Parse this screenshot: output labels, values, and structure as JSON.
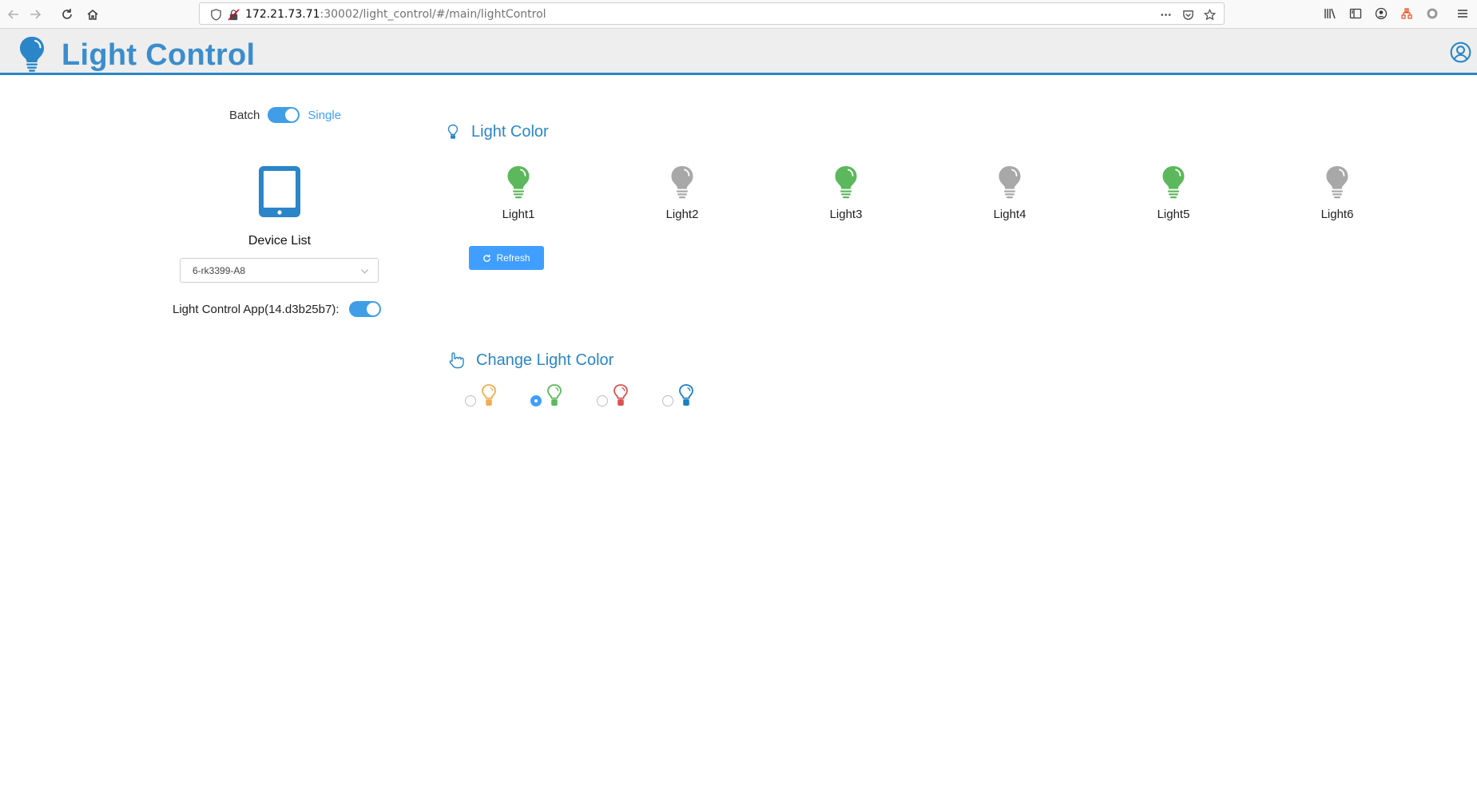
{
  "browser": {
    "url_host": "172.21.73.71",
    "url_rest": ":30002/light_control/#/main/lightControl"
  },
  "header": {
    "title": "Light Control"
  },
  "left_panel": {
    "mode_toggle": {
      "left_label": "Batch",
      "right_label": "Single",
      "active": "Single"
    },
    "device_list_title": "Device List",
    "device_select_value": "6-rk3399-A8",
    "app_toggle_label": "Light Control App(14.d3b25b7):",
    "app_toggle_on": true
  },
  "light_color": {
    "title": "Light Color",
    "lights": [
      {
        "label": "Light1",
        "state": "on"
      },
      {
        "label": "Light2",
        "state": "off"
      },
      {
        "label": "Light3",
        "state": "on"
      },
      {
        "label": "Light4",
        "state": "off"
      },
      {
        "label": "Light5",
        "state": "on"
      },
      {
        "label": "Light6",
        "state": "off"
      }
    ],
    "refresh_label": "Refresh"
  },
  "change_light_color": {
    "title": "Change Light Color",
    "options": [
      {
        "color": "#f0ad4e",
        "selected": false
      },
      {
        "color": "#5cb85c",
        "selected": true
      },
      {
        "color": "#d9534f",
        "selected": false
      },
      {
        "color": "#1b7fc4",
        "selected": false
      }
    ]
  },
  "colors": {
    "accent": "#409eff",
    "brand_blue": "#2a86c8",
    "light_on": "#5cb85c",
    "light_off": "#a8a8a8"
  },
  "icons": [
    "back-icon",
    "forward-icon",
    "reload-icon",
    "home-icon",
    "shield-icon",
    "insecure-lock-icon",
    "more-icon",
    "pocket-icon",
    "star-icon",
    "library-icon",
    "sidebar-icon",
    "account-icon",
    "extension-icon",
    "menu-icon",
    "bulb-logo-icon",
    "user-icon",
    "tablet-icon",
    "bulb-outline-icon",
    "hand-pointer-icon",
    "refresh-icon"
  ]
}
